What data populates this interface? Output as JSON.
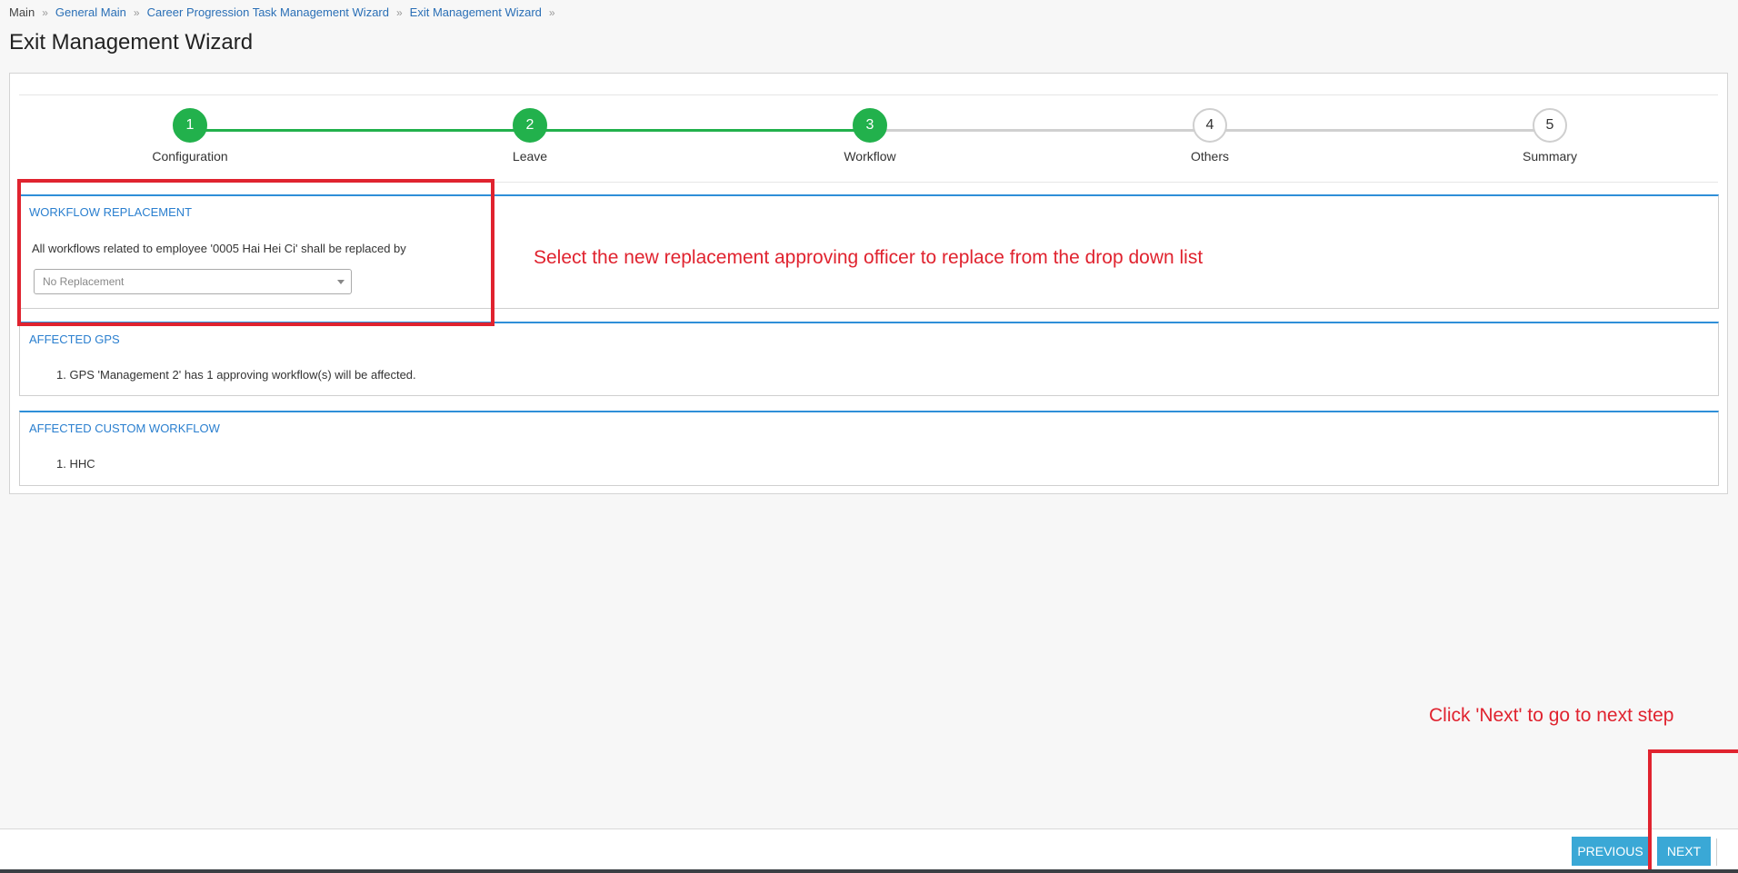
{
  "breadcrumb": {
    "root": "Main",
    "items": [
      "General Main",
      "Career Progression Task Management Wizard",
      "Exit Management Wizard"
    ],
    "separator": "»"
  },
  "page": {
    "title": "Exit Management Wizard"
  },
  "wizard": {
    "steps": [
      {
        "number": "1",
        "label": "Configuration",
        "state": "done"
      },
      {
        "number": "2",
        "label": "Leave",
        "state": "done"
      },
      {
        "number": "3",
        "label": "Workflow",
        "state": "done"
      },
      {
        "number": "4",
        "label": "Others",
        "state": "todo"
      },
      {
        "number": "5",
        "label": "Summary",
        "state": "todo"
      }
    ],
    "colors": {
      "done": "#22b14c",
      "todo": "#cfcfcf",
      "accent": "#2f8fd8",
      "button": "#3aa8d6"
    }
  },
  "workflow_replacement": {
    "title": "WORKFLOW REPLACEMENT",
    "text": "All workflows related to employee '0005 Hai Hei Ci' shall be replaced by",
    "select": {
      "value": "No Replacement"
    }
  },
  "affected_gps": {
    "title": "AFFECTED GPS",
    "items": [
      "1. GPS 'Management 2' has 1 approving workflow(s) will be affected."
    ]
  },
  "affected_custom": {
    "title": "AFFECTED CUSTOM WORKFLOW",
    "items": [
      "1. HHC"
    ]
  },
  "annotations": {
    "select_hint": "Select the new replacement approving officer to replace from the drop down list",
    "next_hint": "Click 'Next' to go to next step",
    "color": "#e0232f"
  },
  "footer": {
    "previous_label": "PREVIOUS",
    "next_label": "NEXT"
  }
}
